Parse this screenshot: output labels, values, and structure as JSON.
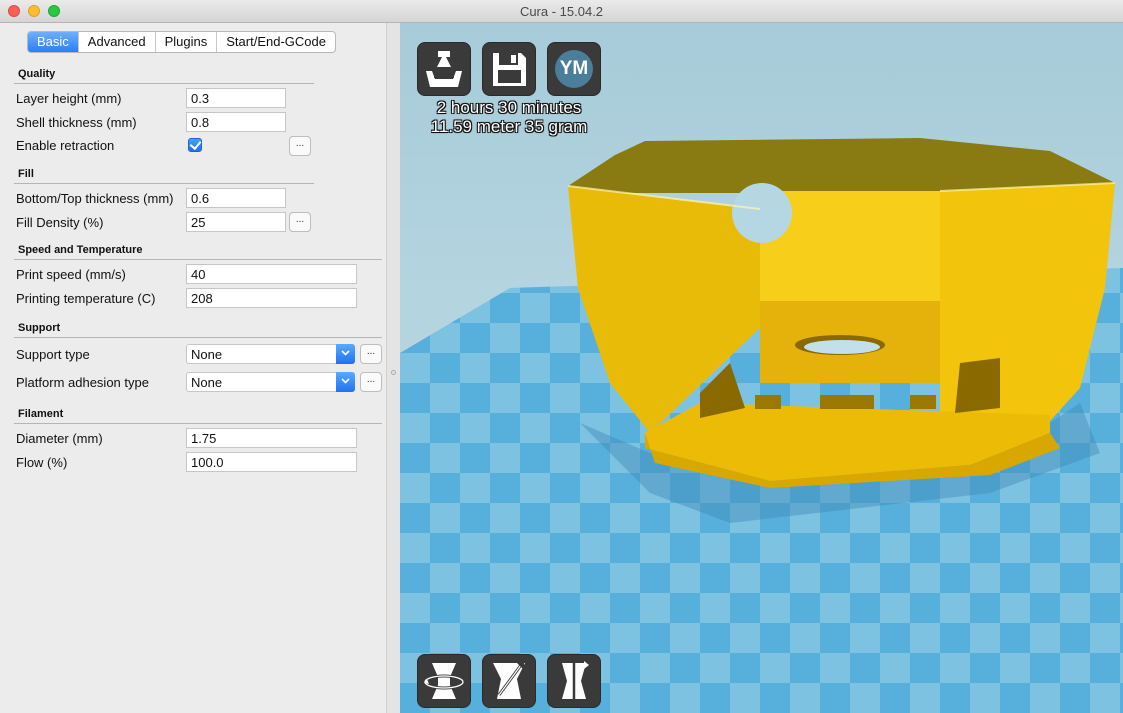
{
  "window": {
    "title": "Cura - 15.04.2"
  },
  "tabs": [
    {
      "label": "Basic",
      "active": true
    },
    {
      "label": "Advanced",
      "active": false
    },
    {
      "label": "Plugins",
      "active": false
    },
    {
      "label": "Start/End-GCode",
      "active": false
    }
  ],
  "quality": {
    "heading": "Quality",
    "layer_height": {
      "label": "Layer height (mm)",
      "value": "0.3"
    },
    "shell_thickness": {
      "label": "Shell thickness (mm)",
      "value": "0.8"
    },
    "retraction": {
      "label": "Enable retraction",
      "checked": true,
      "more": "..."
    }
  },
  "fill": {
    "heading": "Fill",
    "bottom_top": {
      "label": "Bottom/Top thickness (mm)",
      "value": "0.6"
    },
    "density": {
      "label": "Fill Density (%)",
      "value": "25",
      "more": "..."
    }
  },
  "speed": {
    "heading": "Speed and Temperature",
    "print_speed": {
      "label": "Print speed (mm/s)",
      "value": "40"
    },
    "temperature": {
      "label": "Printing temperature (C)",
      "value": "208"
    }
  },
  "support": {
    "heading": "Support",
    "support_type": {
      "label": "Support type",
      "value": "None",
      "more": "..."
    },
    "adhesion": {
      "label": "Platform adhesion type",
      "value": "None",
      "more": "..."
    }
  },
  "filament": {
    "heading": "Filament",
    "diameter": {
      "label": "Diameter (mm)",
      "value": "1.75"
    },
    "flow": {
      "label": "Flow (%)",
      "value": "100.0"
    }
  },
  "viewport": {
    "print_time": "2 hours 30 minutes",
    "material": "11.59 meter 35 gram",
    "top_buttons": [
      "load-model-icon",
      "save-gcode-icon",
      "youmagine-icon"
    ],
    "ym_label": "YM",
    "bottom_buttons": [
      "rotate-icon",
      "scale-icon",
      "mirror-icon"
    ],
    "model_color": "#f5c800",
    "plate_color_a": "#5ab3dd",
    "plate_color_b": "#8ecbe6"
  }
}
